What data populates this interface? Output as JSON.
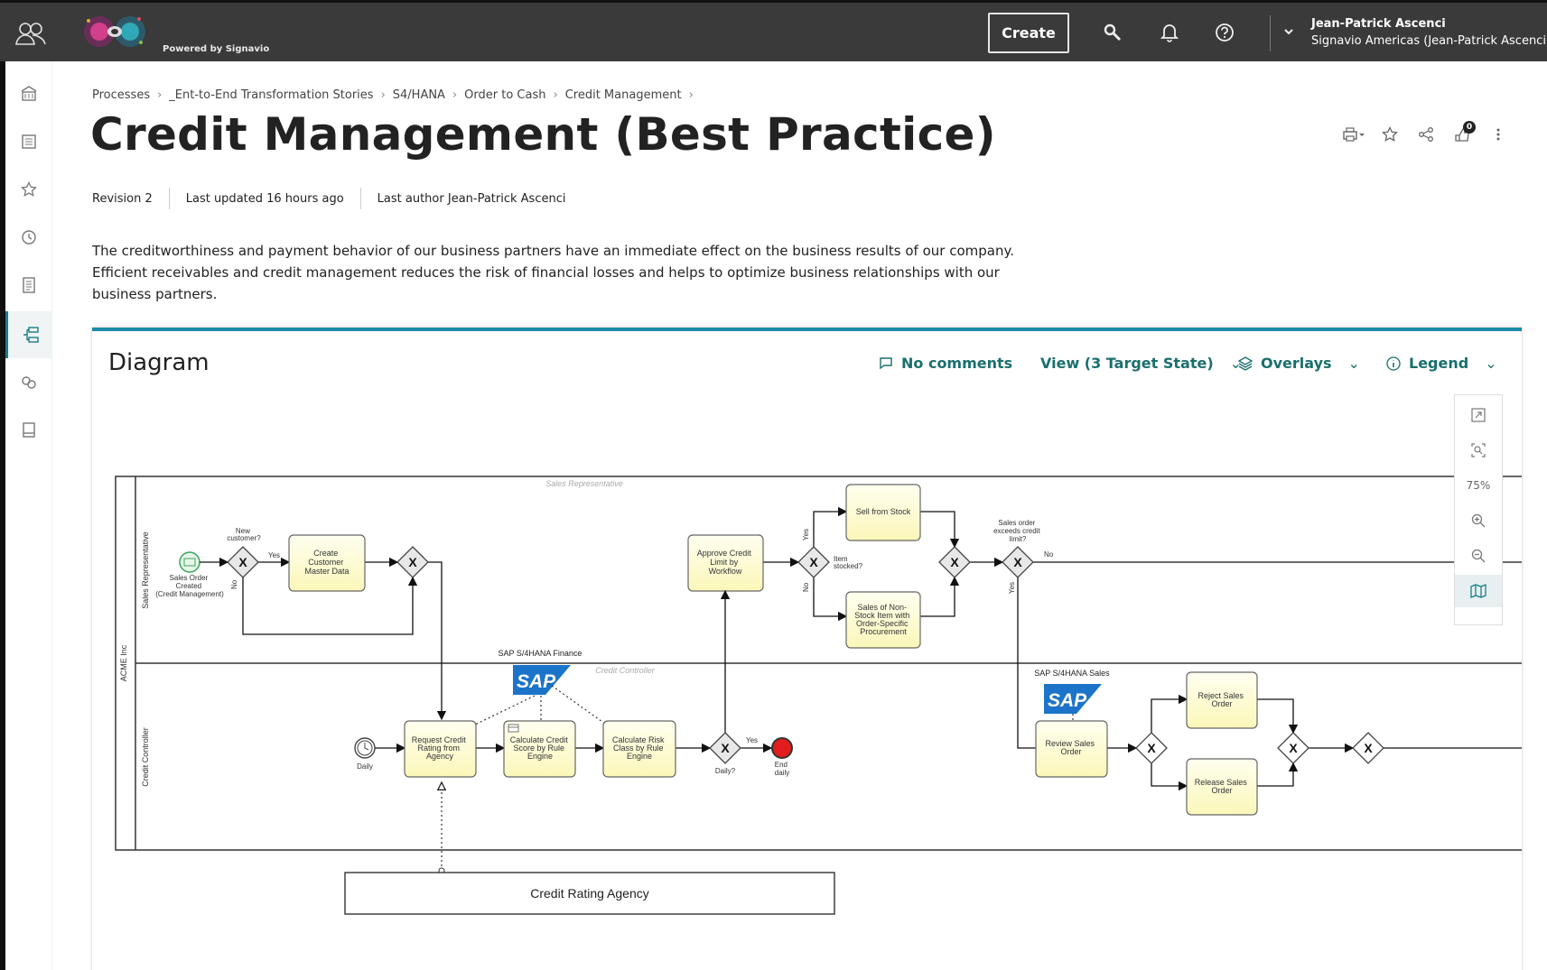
{
  "topbar": {
    "logo_tagline": "Powered by Signavio",
    "create_label": "Create",
    "user_name": "Jean-Patrick Ascenci",
    "user_org": "Signavio Americas (Jean-Patrick Ascenci)"
  },
  "breadcrumbs": [
    "Processes",
    "_Ent-to-End Transformation Stories",
    "S4/HANA",
    "Order to Cash",
    "Credit Management"
  ],
  "page": {
    "title": "Credit Management (Best Practice)",
    "revision": "Revision 2",
    "last_updated": "Last updated 16 hours ago",
    "last_author": "Last author Jean-Patrick Ascenci",
    "description": "The creditworthiness and payment behavior of our business partners have an immediate effect on the business results of our company. Efficient receivables and credit management reduces the risk of financial losses and helps to optimize business relationships with our business partners.",
    "feedback_count": "0"
  },
  "panel": {
    "title": "Diagram",
    "comments": "No comments",
    "view": "View (3 Target State)",
    "overlays": "Overlays",
    "legend": "Legend",
    "zoom": "75%"
  },
  "diagram": {
    "pool": "ACME Inc",
    "lane_sales": "Sales Representative",
    "lane_credit": "Credit Controller",
    "lane_sales_faded": "Sales Representative",
    "lane_credit_faded": "Credit Controller",
    "start_event": [
      "Sales Order",
      "Created",
      "(Credit Management)"
    ],
    "gw_new_customer": [
      "New",
      "customer?"
    ],
    "yes": "Yes",
    "no": "No",
    "task_create_customer": [
      "Create",
      "Customer",
      "Master Data"
    ],
    "task_approve_credit": [
      "Approve Credit",
      "Limit by",
      "Workflow"
    ],
    "gw_item_stocked": [
      "Item",
      "stocked?"
    ],
    "task_sell_from_stock": [
      "Sell from Stock"
    ],
    "task_non_stock": [
      "Sales of Non-",
      "Stock Item with",
      "Order-Specific",
      "Procurement"
    ],
    "gw_exceeds": [
      "Sales order",
      "exceeds credit",
      "limit?"
    ],
    "sap_finance": "SAP S/4HANA Finance",
    "sap_sales": "SAP S/4HANA Sales",
    "sap_logo": "SAP",
    "timer_daily": "Daily",
    "task_request_rating": [
      "Request Credit",
      "Rating from",
      "Agency"
    ],
    "task_calc_score": [
      "Calculate Credit",
      "Score by Rule",
      "Engine"
    ],
    "task_calc_risk": [
      "Calculate Risk",
      "Class by Rule",
      "Engine"
    ],
    "gw_daily": "Daily?",
    "end_daily": [
      "End",
      "daily"
    ],
    "task_review": [
      "Review Sales",
      "Order"
    ],
    "task_reject": [
      "Reject Sales",
      "Order"
    ],
    "task_release": [
      "Release Sales",
      "Order"
    ],
    "external_pool": "Credit Rating Agency"
  },
  "icons": {
    "topbar": [
      "people-icon",
      "search-icon",
      "bell-icon",
      "help-icon",
      "chevron-down-icon"
    ],
    "sidebar": [
      "home-icon",
      "explorer-icon",
      "favorites-icon",
      "history-icon",
      "documents-icon",
      "process-icon",
      "dictionary-icon",
      "book-icon"
    ],
    "actions": [
      "print-icon",
      "star-icon",
      "share-icon",
      "feedback-icon",
      "more-icon"
    ]
  },
  "colors": {
    "accent": "#1c8ba6",
    "task_fill": "#fefecf",
    "sap_blue": "#1b74c9",
    "end_event": "#e11d1d"
  }
}
